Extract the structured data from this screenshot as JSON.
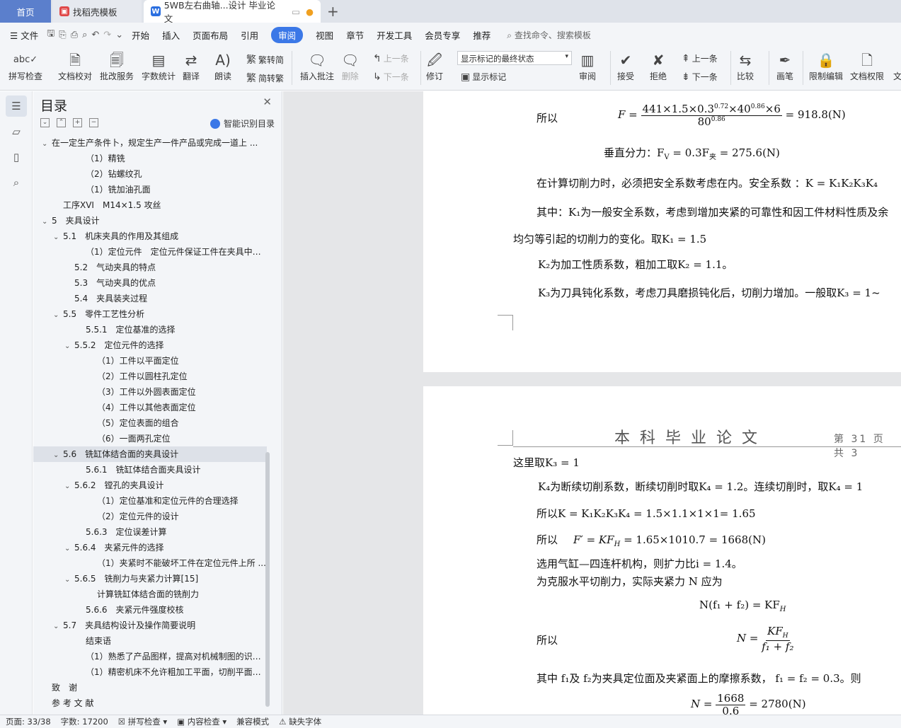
{
  "tabs": {
    "home": "首页",
    "t2": "找稻壳模板",
    "t3": "5WB左右曲轴...设计 毕业论文"
  },
  "menu": {
    "file": "文件",
    "items": [
      "开始",
      "插入",
      "页面布局",
      "引用",
      "审阅",
      "视图",
      "章节",
      "开发工具",
      "会员专享",
      "推荐"
    ],
    "active": "审阅",
    "search": "查找命令、搜索模板"
  },
  "ribbon": {
    "spell": "拼写检查",
    "doccheck": "文档校对",
    "revise": "批改服务",
    "count": "字数统计",
    "translate": "翻译",
    "read": "朗读",
    "trad": "繁转简",
    "simp": "简转繁",
    "insert_comment": "插入批注",
    "delete": "删除",
    "prev": "上一条",
    "next": "下一条",
    "revise2": "修订",
    "markup_state": "显示标记的最终状态",
    "show_markup": "显示标记",
    "review": "审阅",
    "accept": "接受",
    "reject": "拒绝",
    "prev2": "上一条",
    "next2": "下一条",
    "compare": "比较",
    "pen": "画笔",
    "restrict": "限制编辑",
    "perm": "文档权限",
    "more": "文"
  },
  "toc": {
    "title": "目录",
    "smart": "智能识别目录",
    "items": [
      {
        "t": "在一定生产条件卜，规定生产一件产品或完成一道上 ...",
        "l": 0,
        "a": "v"
      },
      {
        "t": "（1）精铣",
        "l": 3,
        "a": ""
      },
      {
        "t": "（2）钻螺纹孔",
        "l": 3,
        "a": ""
      },
      {
        "t": "（1）铣加油孔面",
        "l": 3,
        "a": ""
      },
      {
        "t": "工序XVI　M14×1.5 攻丝",
        "l": 1,
        "a": ""
      },
      {
        "t": "5　夹具设计",
        "l": 0,
        "a": "v"
      },
      {
        "t": "5.1　机床夹具的作用及其组成",
        "l": 1,
        "a": "v"
      },
      {
        "t": "（1）定位元件　定位元件保证工件在夹具中处 ...",
        "l": 3,
        "a": ""
      },
      {
        "t": "5.2　气动夹具的特点",
        "l": 2,
        "a": ""
      },
      {
        "t": "5.3　气动夹具的优点",
        "l": 2,
        "a": ""
      },
      {
        "t": "5.4　夹具装夹过程",
        "l": 2,
        "a": ""
      },
      {
        "t": "5.5　零件工艺性分析",
        "l": 1,
        "a": "v"
      },
      {
        "t": "5.5.1　定位基准的选择",
        "l": 3,
        "a": ""
      },
      {
        "t": "5.5.2　定位元件的选择",
        "l": 2,
        "a": "v"
      },
      {
        "t": "（1）工件以平面定位",
        "l": 4,
        "a": ""
      },
      {
        "t": "（2）工件以圆柱孔定位",
        "l": 4,
        "a": ""
      },
      {
        "t": "（3）工件以外圆表面定位",
        "l": 4,
        "a": ""
      },
      {
        "t": "（4）工件以其他表面定位",
        "l": 4,
        "a": ""
      },
      {
        "t": "（5）定位表面的组合",
        "l": 4,
        "a": ""
      },
      {
        "t": "（6）一面两孔定位",
        "l": 4,
        "a": ""
      },
      {
        "t": "5.6　铣缸体结合面的夹具设计",
        "l": 1,
        "a": "v",
        "sel": true
      },
      {
        "t": "5.6.1　铣缸体结合面夹具设计",
        "l": 3,
        "a": ""
      },
      {
        "t": "5.6.2　镗孔的夹具设计",
        "l": 2,
        "a": "v"
      },
      {
        "t": "（1）定位基准和定位元件的合理选择",
        "l": 4,
        "a": ""
      },
      {
        "t": "（2）定位元件的设计",
        "l": 4,
        "a": ""
      },
      {
        "t": "5.6.3　定位误差计算",
        "l": 3,
        "a": ""
      },
      {
        "t": "5.6.4　夹紧元件的选择",
        "l": 2,
        "a": "v"
      },
      {
        "t": "（1）夹紧时不能破坏工件在定位元件上所 ...",
        "l": 4,
        "a": ""
      },
      {
        "t": "5.6.5　铣削力与夹紧力计算[15]",
        "l": 2,
        "a": "v"
      },
      {
        "t": "计算铣缸体结合面的铣削力",
        "l": 4,
        "a": ""
      },
      {
        "t": "5.6.6　夹紧元件强度校核",
        "l": 3,
        "a": ""
      },
      {
        "t": "5.7　夹具结构设计及操作简要说明",
        "l": 1,
        "a": "v"
      },
      {
        "t": "结束语",
        "l": 3,
        "a": ""
      },
      {
        "t": "（1）熟悉了产品图样，提高对机械制图的识别 ...",
        "l": 3,
        "a": ""
      },
      {
        "t": "（1）精密机床不允许粗加工平面，切削平面不 ...",
        "l": 3,
        "a": ""
      },
      {
        "t": "致　谢",
        "l": 0,
        "a": ""
      },
      {
        "t": "参 考 文 献",
        "l": 0,
        "a": ""
      }
    ]
  },
  "page1": {
    "l1a": "所以",
    "f1n": "441×1.5×0.3",
    "e1": "0.72",
    "f1b": "×40",
    "e2": "0.86",
    "f1c": "×6",
    "f1d": "80",
    "e3": "0.86",
    "f1r": "= 918.8(N)",
    "f1F": "F =",
    "l2": "垂直分力：F",
    "l2b": "V",
    "l2c": " = 0.3F",
    "l2d": "夹",
    "l2e": " = 275.6(N)",
    "l3": "在计算切削力时，必须把安全系数考虑在内。安全系数 ：K = K₁K₂K₃K₄",
    "l4": "其中：K₁为一般安全系数，考虑到增加夹紧的可靠性和因工件材料性质及余",
    "l5": "均匀等引起的切削力的变化。取K₁ = 1.5",
    "l6": "K₂为加工性质系数，粗加工取K₂ = 1.1。",
    "l7": "K₃为刀具钝化系数，考虑刀具磨损钝化后，切削力增加。一般取K₃ = 1~"
  },
  "page2": {
    "header": "本科毕业论文",
    "pagenum": "第 31 页　共 3",
    "l1": "这里取K₃ = 1",
    "l2": "K₄为断续切削系数，断续切削时取K₄ = 1.2。连续切削时，取K₄ = 1",
    "l3": "所以K = K₁K₂K₃K₄ = 1.5×1.1×1×1= 1.65",
    "l4a": "所以",
    "l4b": "F′ = KF",
    "l4c": "H",
    "l4d": " = 1.65×1010.7 = 1668(N)",
    "l5": "选用气缸—四连杆机构，则扩力比i = 1.4。",
    "l6": "为克服水平切削力，实际夹紧力 N 应为",
    "l7": "N(f₁ + f₂) = KF",
    "l7s": "H",
    "l8a": "所以",
    "l8b": "N =",
    "l8n": "KF",
    "l8ns": "H",
    "l8d": "f₁ + f₂",
    "l9": "其中 f₁及 f₂为夹具定位面及夹紧面上的摩擦系数， f₁ = f₂ = 0.3。则",
    "l10a": "N =",
    "l10n": "1668",
    "l10d": "0.6",
    "l10r": "= 2780(N)"
  },
  "status": {
    "page": "页面: 33/38",
    "words": "字数: 17200",
    "spell": "拼写检查",
    "content": "内容检查",
    "compat": "兼容模式",
    "missing": "缺失字体"
  }
}
